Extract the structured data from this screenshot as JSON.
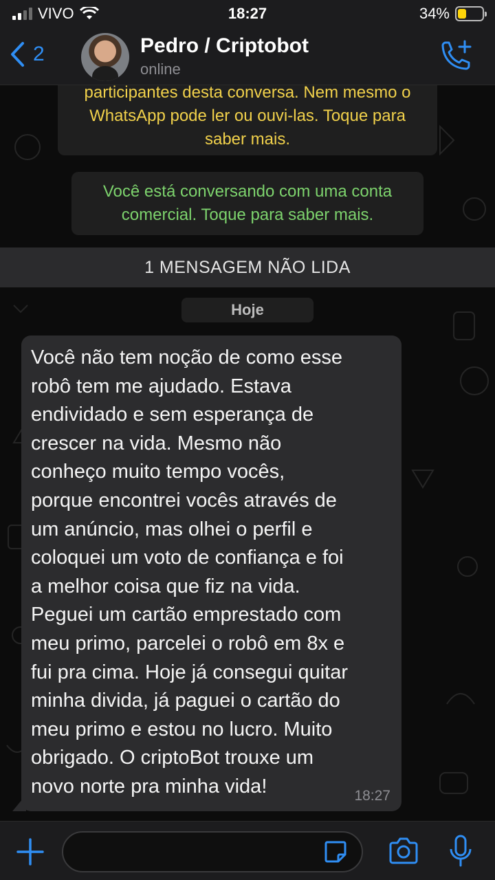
{
  "status_bar": {
    "carrier": "VIVO",
    "time": "18:27",
    "battery": "34%",
    "battery_level": 0.34
  },
  "header": {
    "back_count": "2",
    "contact_name": "Pedro / Criptobot",
    "contact_status": "online"
  },
  "notices": {
    "encryption": "participantes desta conversa. Nem mesmo o\nWhatsApp pode ler ou ouvi-las. Toque para\nsaber mais.",
    "business": "Você está conversando com uma conta\ncomercial. Toque para saber mais."
  },
  "unread_label": "1 MENSAGEM NÃO LIDA",
  "date_chip": "Hoje",
  "message": {
    "text": "Você não tem noção de como esse\nrobô tem me ajudado. Estava\nendividado e sem esperança de\ncrescer na vida. Mesmo não\nconheço muito tempo vocês,\nporque encontrei vocês através de\num anúncio, mas olhei o perfil e\ncoloquei um voto de confiança e foi\na melhor coisa que fiz na vida.\nPeguei um cartão emprestado com\nmeu primo, parcelei o robô em 8x e\nfui pra cima. Hoje já consegui quitar\nminha divida, já paguei o cartão do\nmeu primo e estou no lucro. Muito\nobrigado. O criptoBot trouxe um\nnovo norte pra minha vida!",
    "time": "18:27"
  },
  "colors": {
    "accent": "#2f8ef4",
    "encryption_text": "#f1d14b",
    "business_text": "#7dd36d",
    "battery": "#ffd60a"
  },
  "icons": [
    "signal-icon",
    "wifi-icon",
    "battery-icon",
    "back-chevron-icon",
    "add-call-icon",
    "plus-icon",
    "sticker-icon",
    "camera-icon",
    "microphone-icon"
  ]
}
